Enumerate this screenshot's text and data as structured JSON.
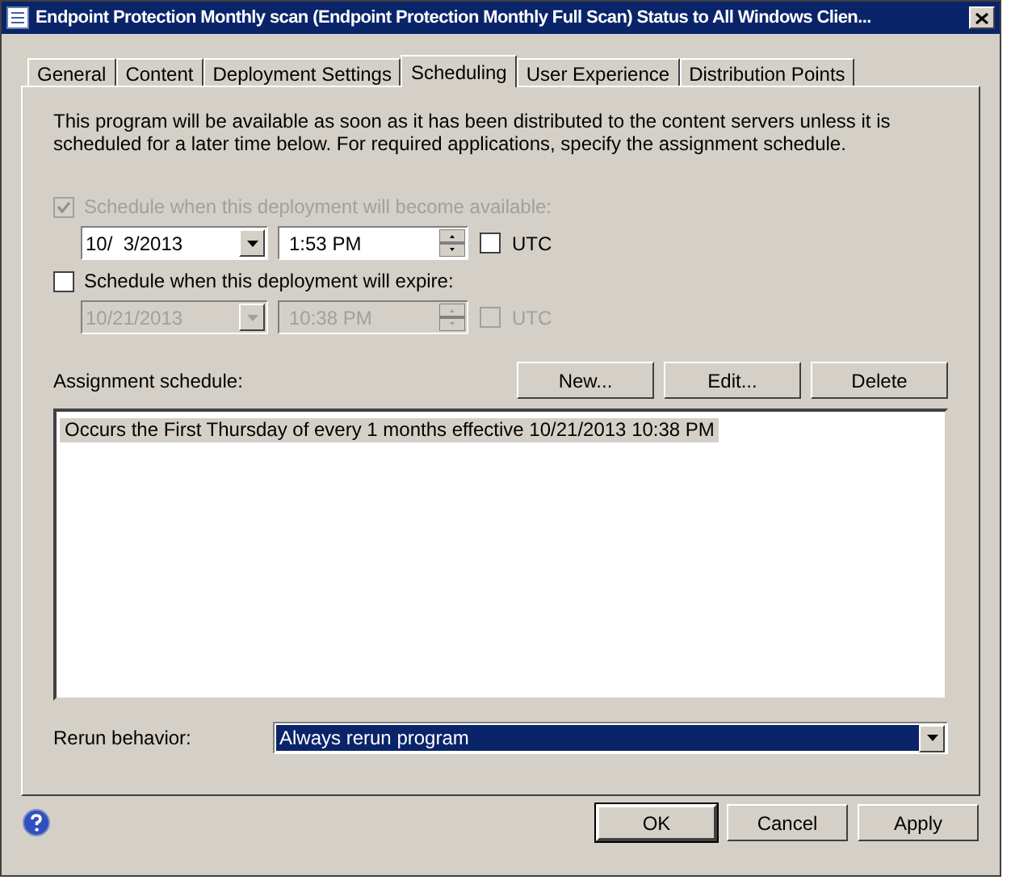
{
  "window": {
    "title": "Endpoint Protection Monthly scan (Endpoint Protection Monthly Full Scan) Status to All Windows Clien..."
  },
  "tabs": [
    {
      "label": "General",
      "selected": false
    },
    {
      "label": "Content",
      "selected": false
    },
    {
      "label": "Deployment Settings",
      "selected": false
    },
    {
      "label": "Scheduling",
      "selected": true
    },
    {
      "label": "User Experience",
      "selected": false
    },
    {
      "label": "Distribution Points",
      "selected": false
    }
  ],
  "description": "This program will be available as soon as it has been distributed to the content servers unless it is scheduled for a later time below. For required applications, specify the assignment schedule.",
  "schedules": [
    {
      "label": "Schedule when this deployment will become available:",
      "checked": true,
      "disabled": true,
      "date": "10/  3/2013",
      "time": "1:53 PM",
      "fields_disabled": false,
      "utc_label": "UTC",
      "utc_checked": false
    },
    {
      "label": "Schedule when this deployment will expire:",
      "checked": false,
      "disabled": false,
      "date": "10/21/2013",
      "time": "10:38 PM",
      "fields_disabled": true,
      "utc_label": "UTC",
      "utc_checked": false
    }
  ],
  "assignment": {
    "label": "Assignment schedule:",
    "buttons": [
      "New...",
      "Edit...",
      "Delete"
    ],
    "entries": [
      {
        "text": "Occurs the First Thursday of every 1 months effective 10/21/2013 10:38 PM",
        "selected": true
      }
    ]
  },
  "rerun": {
    "label": "Rerun behavior:",
    "value": "Always rerun program"
  },
  "buttons": [
    {
      "label": "OK",
      "default": true
    },
    {
      "label": "Cancel",
      "default": false
    },
    {
      "label": "Apply",
      "default": false
    }
  ]
}
